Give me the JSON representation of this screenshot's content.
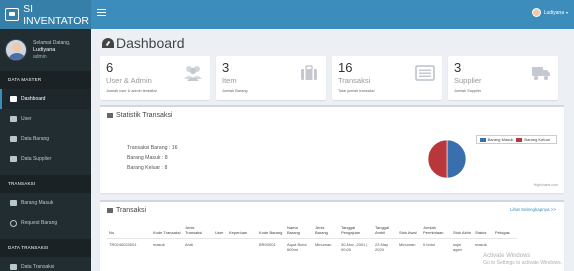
{
  "brand": {
    "name": "SI INVENTATOR"
  },
  "user_panel": {
    "greeting": "Selamat Datang,",
    "name": "Ludiyana",
    "role": "admin"
  },
  "sidebar": {
    "sections": [
      {
        "header": "DATA MASTER",
        "items": [
          {
            "label": "Dashboard",
            "icon": "dashboard-icon",
            "active": true
          },
          {
            "label": "User",
            "icon": "users-icon",
            "active": false
          },
          {
            "label": "Data Barang",
            "icon": "box-icon",
            "active": false
          },
          {
            "label": "Data Supplier",
            "icon": "truck-icon",
            "active": false
          }
        ]
      },
      {
        "header": "TRANSAKSI",
        "items": [
          {
            "label": "Barang Masuk",
            "icon": "inbox-icon",
            "active": false
          },
          {
            "label": "Request Barang",
            "icon": "circle-icon",
            "active": false
          }
        ]
      },
      {
        "header": "DATA TRANSAKSI",
        "items": [
          {
            "label": "Data Transaksi",
            "icon": "list-icon",
            "active": false
          }
        ]
      }
    ]
  },
  "topbar": {
    "user": "Ludiyana"
  },
  "page": {
    "title": "Dashboard"
  },
  "stats": [
    {
      "value": "6",
      "label": "User & Admin",
      "sub": "Jumlah user & admin terdaftar",
      "icon": "users-icon"
    },
    {
      "value": "3",
      "label": "Item",
      "sub": "Jumlah Barang",
      "icon": "briefcase-icon"
    },
    {
      "value": "16",
      "label": "Transaksi",
      "sub": "Total jumlah transaksi",
      "icon": "list-alt-icon"
    },
    {
      "value": "3",
      "label": "Supplier",
      "sub": "Jumlah Supplier",
      "icon": "truck-icon"
    }
  ],
  "statistik": {
    "title": "Statistik Transaksi",
    "lines": [
      "Transaksi Barang : 16",
      "Barang Masuk : 8",
      "Barang Keluar : 8"
    ],
    "credit": "Highcharts.com"
  },
  "chart_data": {
    "type": "pie",
    "title": "",
    "categories": [
      "Barang Masuk",
      "Barang Keluar"
    ],
    "values": [
      8,
      8
    ],
    "colors": [
      "#3a6fae",
      "#b8373b"
    ],
    "legend": "top-right"
  },
  "transaksi": {
    "title": "Transaksi",
    "link": "Lihat Selengkapnya >>",
    "columns": [
      "No",
      "Kode Transaksi",
      "Jenis Transaksi",
      "User",
      "Keperluan",
      "Kode Barang",
      "Nama Barang",
      "Jenis Barang",
      "Tanggal Pengajuan",
      "Tanggal Ambil",
      "Stok Awal",
      "Jumlah Permintaan",
      "Stok Akhir",
      "Status",
      "Petugas"
    ],
    "rows": [
      [
        "TR0240023001",
        "masuk",
        "Andi",
        "",
        "",
        "BR00001",
        "Aqua Botol 600ml",
        "Minuman",
        "30-Nov -2001 | 00:00",
        "23 May 2024",
        "Minuman",
        "0 botol",
        "sujei agen",
        "masuk",
        ""
      ]
    ]
  },
  "watermark": {
    "line1": "Activate Windows",
    "line2": "Go to Settings to activate Windows."
  }
}
